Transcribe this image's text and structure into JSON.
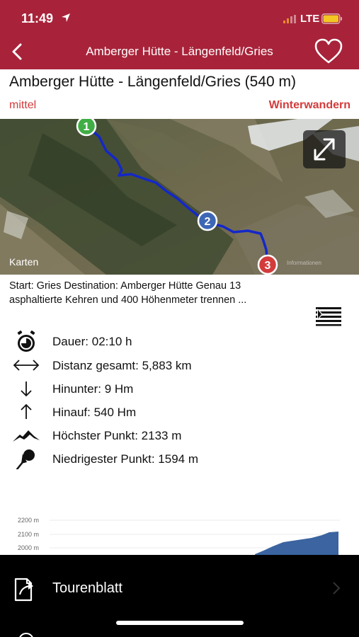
{
  "status_bar": {
    "time": "11:49",
    "network": "LTE"
  },
  "nav": {
    "title": "Amberger Hütte - Längenfeld/Gries"
  },
  "tour": {
    "title": "Amberger Hütte - Längenfeld/Gries (540 m)",
    "difficulty": "mittel",
    "category": "Winterwandern"
  },
  "map": {
    "maps_label": "Karten",
    "legal_label": "Informationen",
    "waypoints": [
      "1",
      "2",
      "3"
    ],
    "route_color": "#1428c8"
  },
  "description": {
    "line1": "Start: Gries Destination: Amberger Hütte    Genau 13",
    "line2": "asphaltierte Kehren und 400 Höhenmeter trennen ..."
  },
  "stats": [
    {
      "icon": "stopwatch-icon",
      "text": "Dauer: 02:10 h"
    },
    {
      "icon": "double-arrow-icon",
      "text": "Distanz gesamt: 5,883 km"
    },
    {
      "icon": "arrow-down-icon",
      "text": "Hinunter: 9 Hm"
    },
    {
      "icon": "arrow-up-icon",
      "text": "Hinauf: 540 Hm"
    },
    {
      "icon": "mountain-peak-icon",
      "text": "Höchster Punkt: 2133 m"
    },
    {
      "icon": "pushpin-icon",
      "text": "Niedrigester Punkt: 1594 m"
    }
  ],
  "profile": {
    "y_labels": [
      "2200 m",
      "2100 m",
      "2000 m"
    ],
    "fill_color": "#3b64a0"
  },
  "bottom_bar": {
    "tourenblatt_label": "Tourenblatt"
  },
  "colors": {
    "brand": "#a8233a",
    "accent_red": "#d33b3b"
  }
}
